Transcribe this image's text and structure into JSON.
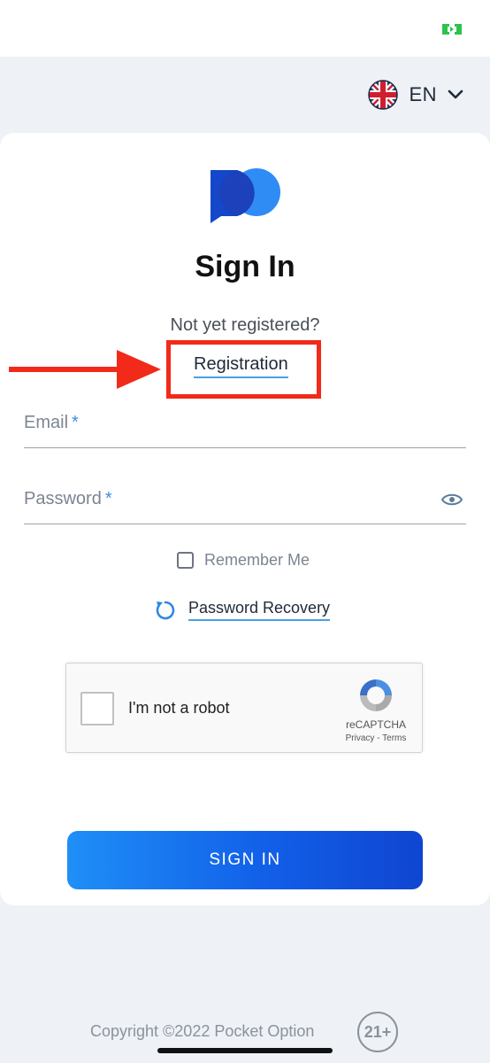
{
  "colors": {
    "accent": "#1260e8",
    "link_underline": "#4aa0e6",
    "required_star": "#3d8fe0",
    "annotation_red": "#f12a1a",
    "background": "#eef1f6"
  },
  "status_bar": {
    "indicator_icon": "battery-charging-icon"
  },
  "language": {
    "label": "EN",
    "flag_icon": "uk-flag-icon",
    "chevron_icon": "chevron-down-icon"
  },
  "auth": {
    "logo_icon": "pocket-option-logo",
    "title": "Sign In",
    "not_registered": "Not yet registered?",
    "registration_link": "Registration"
  },
  "form": {
    "email_label": "Email",
    "password_label": "Password",
    "required_mark": "*",
    "password_toggle_icon": "eye-icon",
    "remember_me": "Remember Me",
    "recovery_icon": "refresh-icon",
    "recovery_link": "Password Recovery",
    "submit": "SIGN IN"
  },
  "recaptcha": {
    "label": "I'm not a robot",
    "brand": "reCAPTCHA",
    "privacy": "Privacy",
    "separator": "-",
    "terms": "Terms"
  },
  "footer": {
    "copyright": "Copyright ©2022 Pocket Option",
    "age_badge": "21+"
  },
  "annotation": {
    "arrow_icon": "red-arrow-right-icon"
  }
}
